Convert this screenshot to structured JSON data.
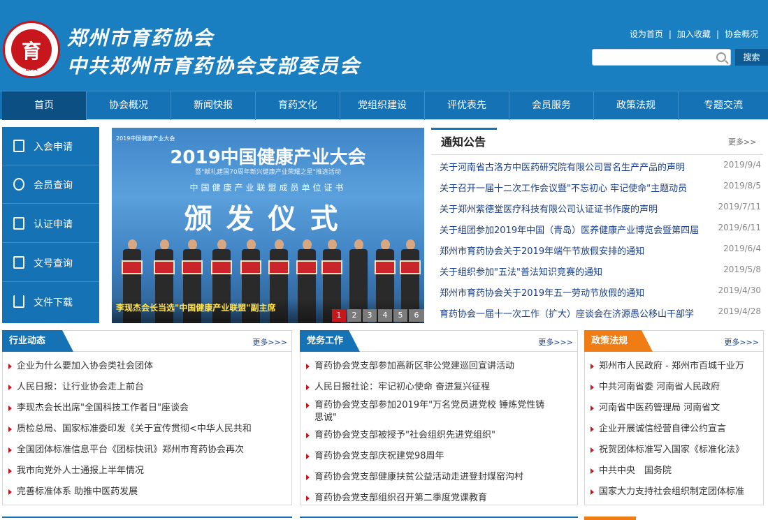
{
  "header": {
    "title_line1": "郑州市育药协会",
    "title_line2": "中共郑州市育药协会支部委员会",
    "logo_mark": "育",
    "logo_zpa": "ZPA",
    "top_links": [
      "设为首页",
      "加入收藏",
      "协会概况"
    ],
    "search_placeholder": "",
    "search_button": "搜索"
  },
  "nav": {
    "items": [
      "首页",
      "协会概况",
      "新闻快报",
      "育药文化",
      "党组织建设",
      "评优表先",
      "会员服务",
      "政策法规",
      "专题交流"
    ]
  },
  "sidebar": {
    "items": [
      "入会申请",
      "会员查询",
      "认证申请",
      "文号查询",
      "文件下载"
    ]
  },
  "banner": {
    "top_label": "2019中国健康产业大会",
    "headline": "2019中国健康产业大会",
    "sub": "暨\"献礼建国70周年新兴健康产业荣耀之星\"推选活动",
    "ceremony_small": "中国健康产业联盟成员单位证书",
    "ceremony": "颁发仪式",
    "caption": "李现杰会长当选\"中国健康产业联盟\"副主席",
    "pages": [
      "1",
      "2",
      "3",
      "4",
      "5",
      "6"
    ],
    "current_page": 1
  },
  "notice": {
    "title": "通知公告",
    "more": "更多>>",
    "items": [
      {
        "text": "关于河南省古洛方中医药研究院有限公司冒名生产产品的声明",
        "date": "2019/9/4"
      },
      {
        "text": "关于召开一届十二次工作会议暨\"不忘初心 牢记使命\"主题动员",
        "date": "2019/8/5"
      },
      {
        "text": "关于郑州紫德堂医疗科技有限公司认证证书作废的声明",
        "date": "2019/7/11"
      },
      {
        "text": "关于组团参加2019年中国（青岛）医养健康产业博览会暨第四届",
        "date": "2019/6/11"
      },
      {
        "text": "郑州市育药协会关于2019年端午节放假安排的通知",
        "date": "2019/6/4"
      },
      {
        "text": "关于组织参加\"五法\"普法知识竞赛的通知",
        "date": "2019/5/8"
      },
      {
        "text": "郑州市育药协会关于2019年五一劳动节放假的通知",
        "date": "2019/4/30"
      },
      {
        "text": "育药协会一届十一次工作（扩大）座谈会在济源愚公移山干部学",
        "date": "2019/4/28"
      }
    ]
  },
  "panels": [
    {
      "title": "行业动态",
      "more": "更多>>>",
      "color": "#1572b5",
      "items": [
        "企业为什么要加入协会类社会团体",
        "人民日报：让行业协会走上前台",
        "李现杰会长出席\"全国科技工作者日\"座谈会",
        "质检总局、国家标准委印发《关于宣传贯彻<中华人民共和",
        "全国团体标准信息平台《团标快讯》郑州市育药协会再次",
        "我市向党外人士通报上半年情况",
        "完善标准体系 助推中医药发展"
      ]
    },
    {
      "title": "党务工作",
      "more": "更多>>>",
      "color": "#1572b5",
      "items": [
        "育药协会党支部参加高新区非公党建巡回宣讲活动",
        "人民日报社论：牢记初心使命 奋进复兴征程",
        "育药协会党支部参加2019年\"万名党员进党校 锤炼党性铸思诚\"",
        "育药协会党支部被授予\"社会组织先进党组织\"",
        "育药协会党支部庆祝建党98周年",
        "育药协会党支部健康扶贫公益活动走进登封煤窑沟村",
        "育药协会党支部组织召开第二季度党课教育"
      ]
    },
    {
      "title": "政策法规",
      "more": "更多>>>",
      "color": "#ef7d13",
      "items": [
        "郑州市人民政府 - 郑州市百城千业万",
        "中共河南省委 河南省人民政府",
        "河南省中医药管理局 河南省文",
        "企业开展诚信经营自律公约宣言",
        "祝贺团体标准写入国家《标准化法》",
        "中共中央　国务院",
        "国家大力支持社会组织制定团体标准"
      ]
    }
  ],
  "colors": {
    "primary": "#1572b5",
    "header": "#1a7fc1",
    "accent_red": "#c8161d",
    "accent_orange": "#ef7d13"
  }
}
